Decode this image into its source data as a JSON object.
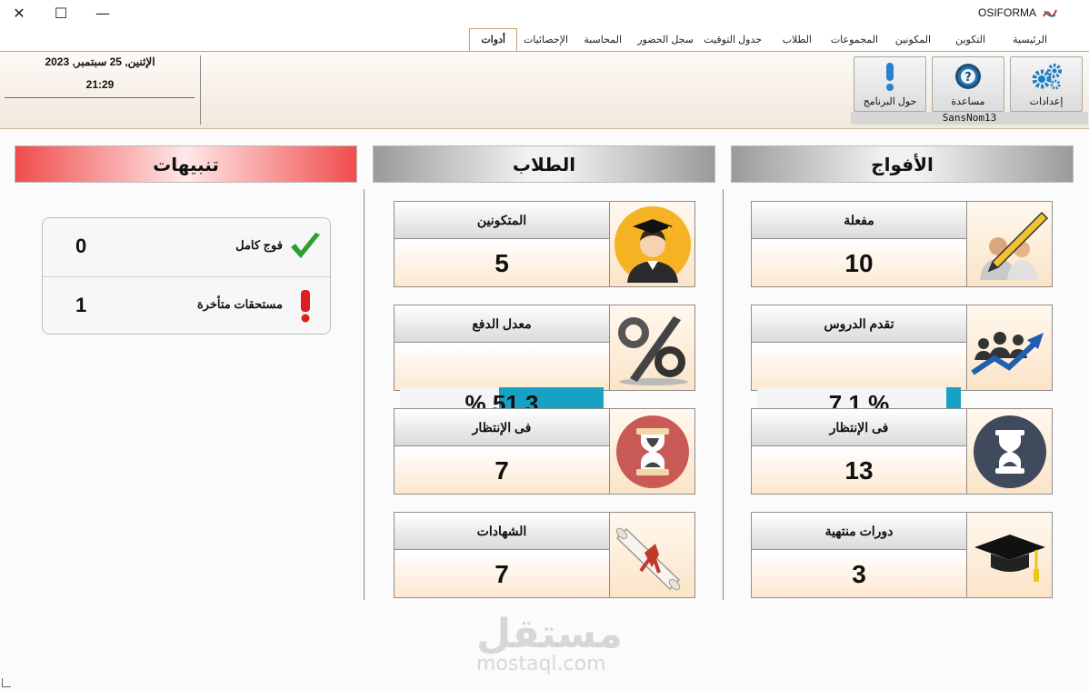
{
  "window": {
    "title": "OSIFORMA",
    "close_glyph": "✕",
    "maximize_glyph": "☐",
    "minimize_glyph": "—"
  },
  "menu": {
    "items": [
      "الرئيسية",
      "التكوين",
      "المكونين",
      "المجموعات",
      "الطلاب",
      "جدول التوقيت",
      "سجل الحضور",
      "المحاسبة",
      "الإحصائيات",
      "أدوات"
    ],
    "active": "أدوات"
  },
  "ribbon": {
    "date": "الإثنين, 25 سبتمبر, 2023",
    "time": "21:29",
    "buttons": {
      "settings": "إعدادات",
      "help": "مساعدة",
      "about": "حول البرنامج"
    },
    "group_label": "SansNom13"
  },
  "panels": {
    "cohorts": {
      "header": "الأفواج",
      "cards": [
        {
          "title": "مفعلة",
          "value": "10",
          "icon": "teacher-writing-icon"
        },
        {
          "title": "تقدم الدروس",
          "value": "7.1 %",
          "progress": 0.071,
          "icon": "growth-chart-icon"
        },
        {
          "title": "فى الإنتظار",
          "value": "13",
          "icon": "hourglass-icon"
        },
        {
          "title": "دورات منتهية",
          "value": "3",
          "icon": "graduation-cap-icon"
        }
      ]
    },
    "students": {
      "header": "الطلاب",
      "cards": [
        {
          "title": "المتكونين",
          "value": "5",
          "icon": "graduate-student-icon"
        },
        {
          "title": "معدل الدفع",
          "value": "% 51.3",
          "progress": 0.513,
          "icon": "percent-icon"
        },
        {
          "title": "فى الإنتظار",
          "value": "7",
          "icon": "hourglass-red-icon"
        },
        {
          "title": "الشهادات",
          "value": "7",
          "icon": "diploma-scroll-icon"
        }
      ]
    },
    "alerts": {
      "header": "تنبيهات",
      "rows": [
        {
          "label": "فوج كامل",
          "value": "0",
          "icon": "checkmark-icon"
        },
        {
          "label": "مستحقات متأخرة",
          "value": "1",
          "icon": "exclamation-icon"
        }
      ]
    }
  },
  "colors": {
    "progress": "#17a2c4",
    "accent_red": "#f04c4c",
    "tab_border": "#c6a27a"
  },
  "watermark": {
    "arabic": "مستقل",
    "latin": "mostaql.com"
  }
}
